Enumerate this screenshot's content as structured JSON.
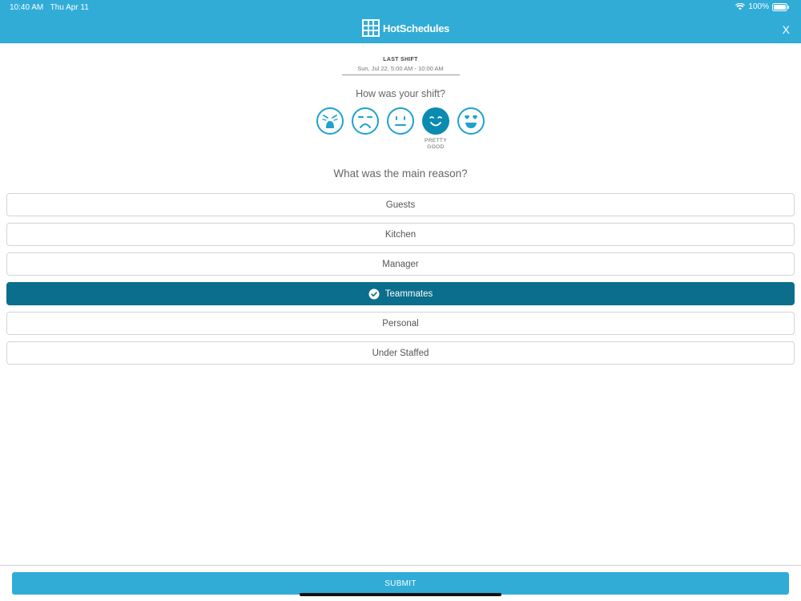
{
  "status_bar": {
    "time": "10:40 AM",
    "date": "Thu Apr 11",
    "battery": "100%"
  },
  "header": {
    "brand": "HotSchedules",
    "close_label": "X"
  },
  "last_shift": {
    "title": "LAST SHIFT",
    "date": "Sun, Jul 22, 5:00 AM - 10:00 AM"
  },
  "question": "How was your shift?",
  "ratings": [
    {
      "icon": "crying-face-icon",
      "selected": false
    },
    {
      "icon": "sad-face-icon",
      "selected": false
    },
    {
      "icon": "neutral-face-icon",
      "selected": false
    },
    {
      "icon": "smiling-face-icon",
      "selected": true,
      "label": "PRETTY GOOD"
    },
    {
      "icon": "heart-eyes-face-icon",
      "selected": false
    }
  ],
  "reason_question": "What was the main reason?",
  "options": [
    {
      "label": "Guests",
      "selected": false
    },
    {
      "label": "Kitchen",
      "selected": false
    },
    {
      "label": "Manager",
      "selected": false
    },
    {
      "label": "Teammates",
      "selected": true
    },
    {
      "label": "Personal",
      "selected": false
    },
    {
      "label": "Under Staffed",
      "selected": false
    }
  ],
  "submit_label": "SUBMIT",
  "colors": {
    "brand": "#30acd7",
    "selected": "#0b6e8c",
    "icon_outline": "#1ea2cf"
  }
}
